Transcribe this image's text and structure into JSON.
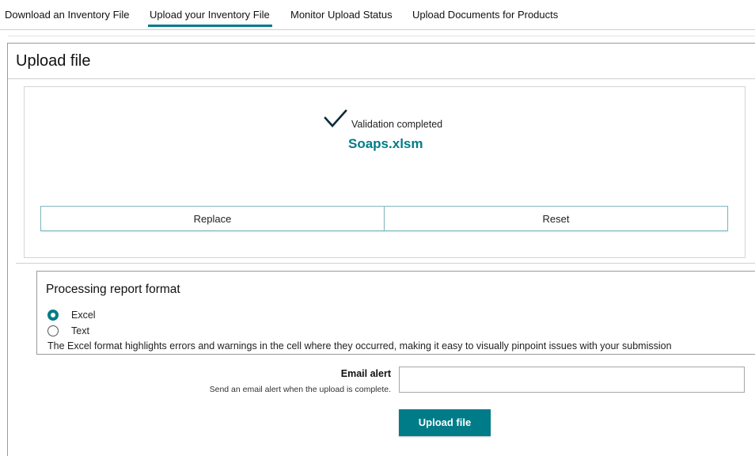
{
  "tabs": [
    {
      "label": "Download an Inventory File",
      "active": false
    },
    {
      "label": "Upload your Inventory File",
      "active": true
    },
    {
      "label": "Monitor Upload Status",
      "active": false
    },
    {
      "label": "Upload Documents for Products",
      "active": false
    }
  ],
  "panel": {
    "title": "Upload file"
  },
  "validation": {
    "status_icon": "checkmark-icon",
    "status_text": "Validation completed",
    "filename": "Soaps.xlsm",
    "replace_label": "Replace",
    "reset_label": "Reset"
  },
  "report_format": {
    "title": "Processing report format",
    "options": [
      {
        "label": "Excel",
        "checked": true
      },
      {
        "label": "Text",
        "checked": false
      }
    ],
    "note": "The Excel format highlights errors and warnings in the cell where they occurred, making it easy to visually pinpoint issues with your submission"
  },
  "email_alert": {
    "label": "Email alert",
    "help": "Send an email alert when the upload is complete.",
    "value": ""
  },
  "upload_button_label": "Upload file",
  "colors": {
    "accent": "#007c88",
    "border": "#9a9a9a"
  }
}
